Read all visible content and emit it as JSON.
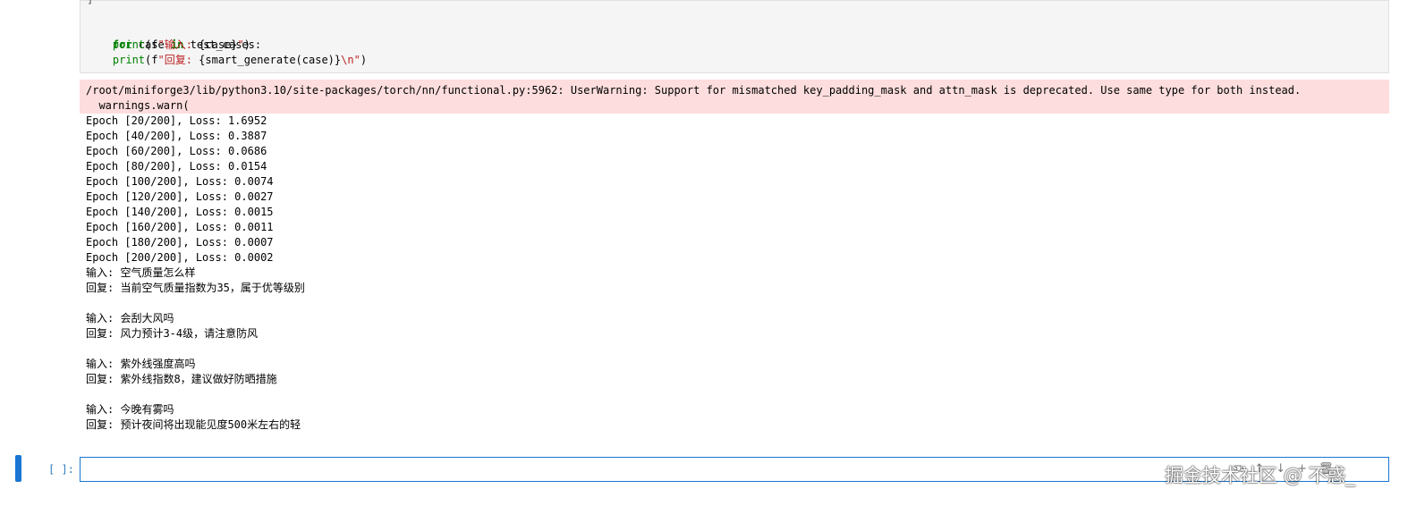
{
  "code_cell": {
    "lines": [
      "]",
      "",
      "for case in test_cases:",
      "    print(f\"输入: {case}\")",
      "    print(f\"回复: {smart_generate(case)}\\n\")"
    ]
  },
  "stderr": {
    "line1": "/root/miniforge3/lib/python3.10/site-packages/torch/nn/functional.py:5962: UserWarning: Support for mismatched key_padding_mask and attn_mask is deprecated. Use same type for both instead.",
    "line2": "  warnings.warn("
  },
  "stdout": [
    "Epoch [20/200], Loss: 1.6952",
    "Epoch [40/200], Loss: 0.3887",
    "Epoch [60/200], Loss: 0.0686",
    "Epoch [80/200], Loss: 0.0154",
    "Epoch [100/200], Loss: 0.0074",
    "Epoch [120/200], Loss: 0.0027",
    "Epoch [140/200], Loss: 0.0015",
    "Epoch [160/200], Loss: 0.0011",
    "Epoch [180/200], Loss: 0.0007",
    "Epoch [200/200], Loss: 0.0002",
    "输入: 空气质量怎么样",
    "回复: 当前空气质量指数为35，属于优等级别",
    "",
    "输入: 会刮大风吗",
    "回复: 风力预计3-4级，请注意防风",
    "",
    "输入: 紫外线强度高吗",
    "回复: 紫外线指数8，建议做好防晒措施",
    "",
    "输入: 今晚有雾吗",
    "回复: 预计夜间将出现能见度500米左右的轻"
  ],
  "next_cell": {
    "prompt": "[ ]:",
    "value": ""
  },
  "watermark": "掘金技术社区 @ 不惑_",
  "colors": {
    "accent": "#1976d2",
    "stderr_bg": "#fddddd",
    "code_bg": "#f5f5f5"
  }
}
